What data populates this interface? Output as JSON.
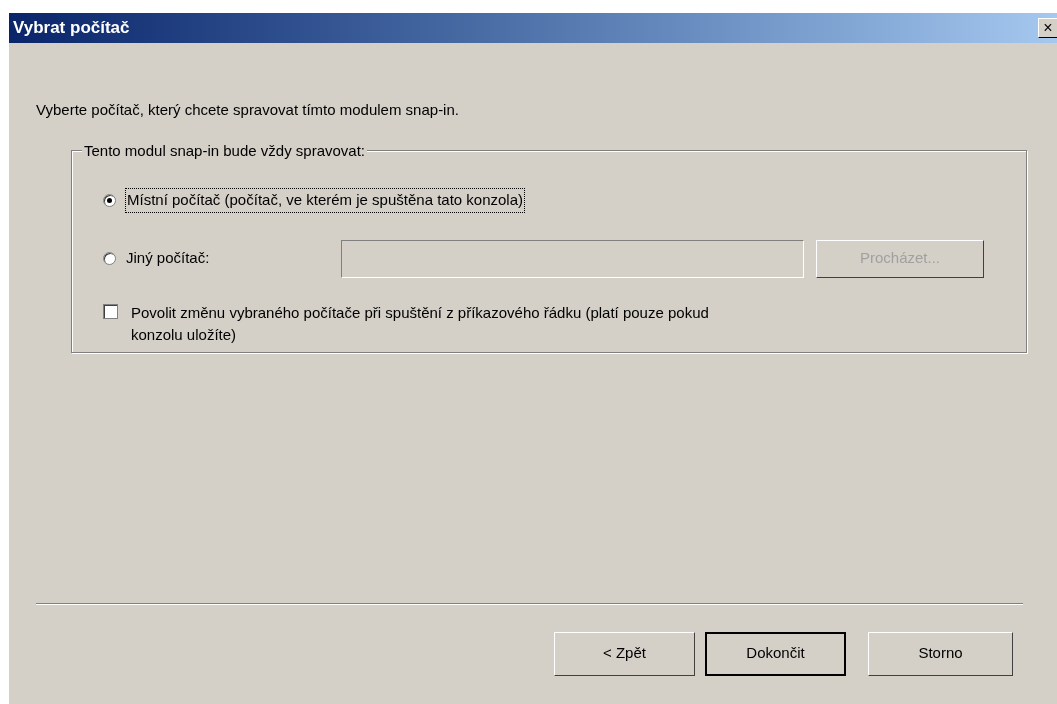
{
  "window": {
    "title": "Vybrat počítač",
    "close": "×"
  },
  "intro": "Vyberte počítač, který chcete spravovat tímto modulem snap-in.",
  "group": {
    "label": "Tento modul snap-in bude vždy spravovat:",
    "options": [
      {
        "label": "Místní počítač (počítač, ve kterém je spuštěna tato konzola)",
        "selected": true
      },
      {
        "label": "Jiný počítač:",
        "selected": false
      }
    ],
    "computer_field": {
      "disabled": true
    },
    "browse_button": {
      "label": "Procházet...",
      "disabled": true
    },
    "allow_change": {
      "label": "Povolit změnu vybraného počítače při spuštění z příkazového řádku (platí pouze pokud konzolu uložíte)",
      "checked": false
    }
  },
  "buttons": [
    {
      "label": "< Zpět",
      "default": false
    },
    {
      "label": "Dokončit",
      "default": true
    },
    {
      "label": "Storno",
      "default": false
    }
  ]
}
